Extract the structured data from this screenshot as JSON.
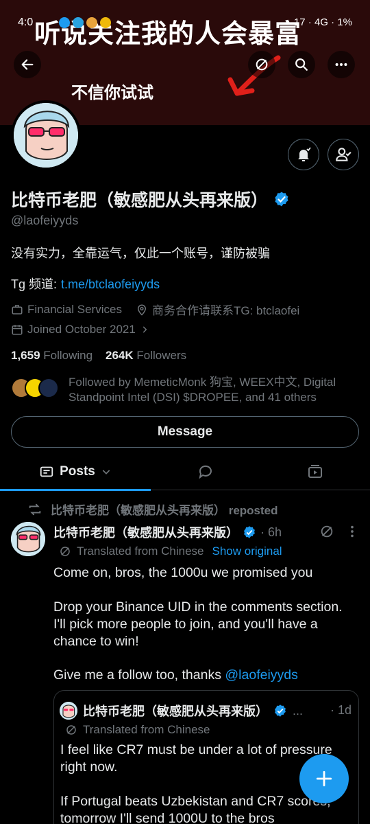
{
  "status_bar": {
    "time": "4:0",
    "right": "17 · 4G · 1%"
  },
  "banner": {
    "headline": "听说关注我的人会暴富",
    "sub": "不信你试试"
  },
  "profile": {
    "name": "比特币老肥（敏感肥从头再来版）",
    "handle": "@laofeiyyds",
    "bio": "没有实力，全靠运气，仅此一个账号，谨防被骗",
    "tg_label": "Tg 频道:",
    "tg_link": "t.me/btclaofeiyyds",
    "category": "Financial Services",
    "location": "商务合作请联系TG: btclaofei",
    "joined": "Joined October 2021",
    "following_count": "1,659",
    "following_label": "Following",
    "followers_count": "264K",
    "followers_label": "Followers",
    "followed_by": "Followed by MemeticMonk 狗宝, WEEX中文, Digital Standpoint Intel (DSI) $DROPEE, and 41 others",
    "message_label": "Message"
  },
  "tabs": {
    "posts": "Posts"
  },
  "post": {
    "repost_by": "比特币老肥（敏感肥从头再来版） reposted",
    "author": "比特币老肥（敏感肥从头再来版）",
    "time": "· 6h",
    "translated": "Translated from Chinese",
    "show_original": "Show original",
    "p1": "Come on, bros, the 1000u we promised you",
    "p2": "Drop your Binance UID in the comments section. I'll pick more people to join, and you'll have a chance to win!",
    "p3": "Give me a follow too, thanks",
    "p3_mention": "@laofeiyyds"
  },
  "quote": {
    "author": "比特币老肥（敏感肥从头再来版）",
    "more": "...",
    "time": "· 1d",
    "translated": "Translated from Chinese",
    "p1": "I feel like CR7 must be under a lot of pressure right now.",
    "p2": "If Portugal beats Uzbekistan and CR7 scores, tomorrow I'll send 1000U to the bros"
  },
  "colors": {
    "accent": "#1d9bf0",
    "muted": "#71767b",
    "text": "#e7e9ea",
    "border": "#2f3336"
  }
}
